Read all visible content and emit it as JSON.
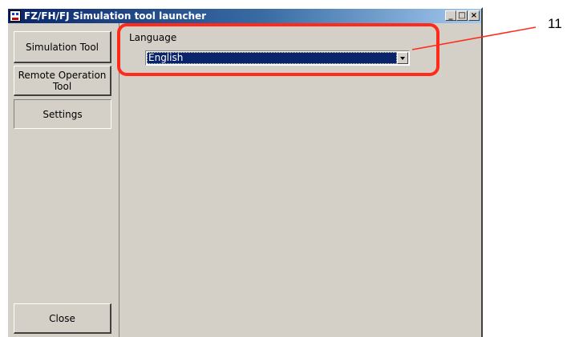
{
  "window": {
    "title": "FZ/FH/FJ Simulation tool launcher",
    "minimize_glyph": "_",
    "maximize_glyph": "□",
    "close_glyph": "×"
  },
  "nav": {
    "items": [
      {
        "label": "Simulation Tool"
      },
      {
        "label": "Remote Operation\nTool"
      },
      {
        "label": "Settings",
        "selected": true
      }
    ],
    "close_label": "Close"
  },
  "settings": {
    "language_label": "Language",
    "language_value": "English"
  },
  "annotation": {
    "callout_number": "11",
    "highlight_color": "#ff2a1a"
  }
}
